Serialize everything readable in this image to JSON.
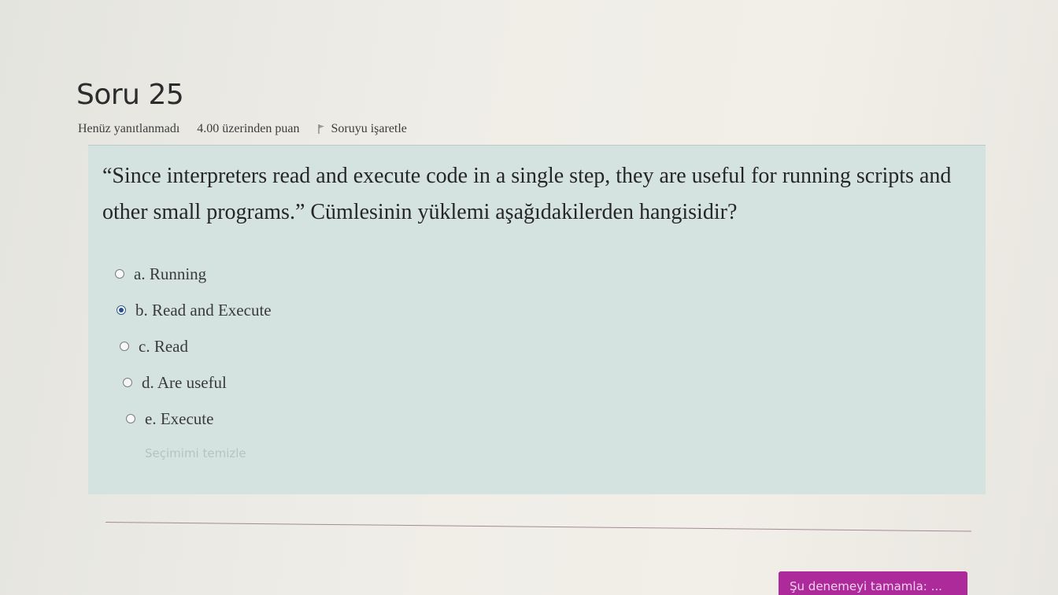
{
  "question": {
    "title": "Soru 25",
    "state": "Henüz yanıtlanmadı",
    "grade": "4.00 üzerinden puan",
    "flag_label": "Soruyu işaretle",
    "text": "“Since interpreters read and execute code in a single step, they are useful for running scripts and other small programs.” Cümlesinin yüklemi aşağıdakilerden hangisidir?",
    "answers": [
      {
        "label": "a. Running",
        "selected": false
      },
      {
        "label": "b. Read and Execute",
        "selected": true
      },
      {
        "label": "c. Read",
        "selected": false
      },
      {
        "label": "d. Are useful",
        "selected": false
      },
      {
        "label": "e. Execute",
        "selected": false
      }
    ],
    "clear_label": "Seçimimi temizle"
  },
  "footer": {
    "finish_label": "Şu denemeyi tamamla: ..."
  },
  "colors": {
    "question_box": "#d5e3e0",
    "finish_button": "#ad2a9a",
    "selected_radio": "#1f4f8f"
  }
}
